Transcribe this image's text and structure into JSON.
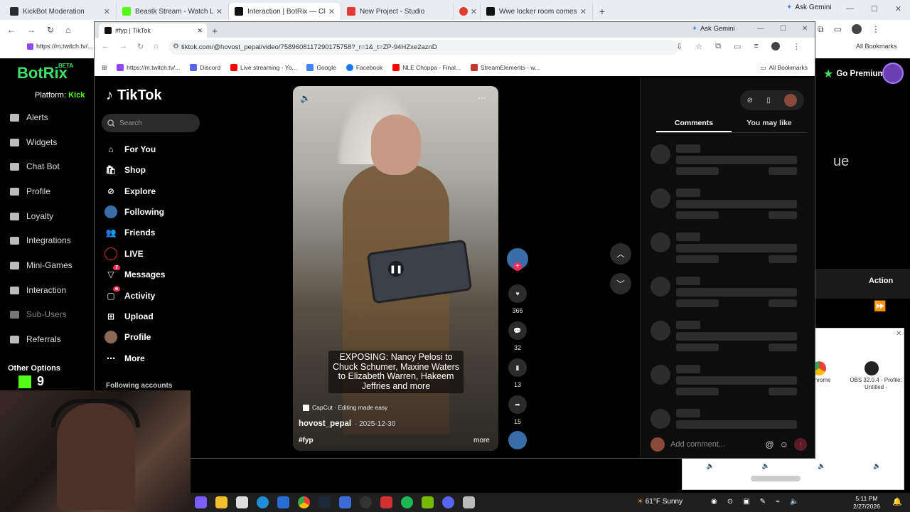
{
  "outer_browser": {
    "tabs": [
      {
        "title": "KickBot Moderation",
        "color": "#2c2c2c"
      },
      {
        "title": "Beastk Stream - Watch Live on",
        "color": "#53fc18"
      },
      {
        "title": "Interaction | BotRix — Cloud Sh",
        "color": "#111111"
      },
      {
        "title": "New Project - Studio",
        "color": "#e53935"
      },
      {
        "title": "",
        "color": "#e53935"
      },
      {
        "title": "Wwe locker room comes out to",
        "color": "#111111"
      }
    ],
    "ask_gemini": "Ask Gemini",
    "bookmark_url": "https://m.twitch.tv/...",
    "all_bookmarks": "All Bookmarks"
  },
  "inner_browser": {
    "tab_title": "#fyp | TikTok",
    "ask_gemini": "Ask Gemini",
    "url": "tiktok.com/@hovost_pepal/video/7589608117290175758?_r=1&_t=ZP-94HZxe2aznD",
    "bookmarks": [
      {
        "label": "https://m.twitch.tv/...",
        "color": "#9146ff"
      },
      {
        "label": "Discord",
        "color": "#5865f2"
      },
      {
        "label": "Live streaming - Yo...",
        "color": "#ff0000"
      },
      {
        "label": "Google",
        "color": "#4285f4"
      },
      {
        "label": "Facebook",
        "color": "#1877f2"
      },
      {
        "label": "NLE Choppa - Final...",
        "color": "#ff0000"
      },
      {
        "label": "StreamElements - w...",
        "color": "#c0392b"
      }
    ],
    "all_bookmarks": "All Bookmarks"
  },
  "tiktok": {
    "logo": "TikTok",
    "search_placeholder": "Search",
    "nav": [
      {
        "label": "For You",
        "icon": "home-icon"
      },
      {
        "label": "Shop",
        "icon": "shop-icon"
      },
      {
        "label": "Explore",
        "icon": "compass-icon"
      },
      {
        "label": "Following",
        "icon": "following-avatar-icon"
      },
      {
        "label": "Friends",
        "icon": "friends-icon"
      },
      {
        "label": "LIVE",
        "icon": "live-icon"
      },
      {
        "label": "Messages",
        "icon": "messages-icon",
        "badge": "7"
      },
      {
        "label": "Activity",
        "icon": "activity-icon",
        "badge": "6"
      },
      {
        "label": "Upload",
        "icon": "upload-icon"
      },
      {
        "label": "Profile",
        "icon": "profile-avatar-icon"
      },
      {
        "label": "More",
        "icon": "more-icon"
      }
    ],
    "following_accounts": "Following accounts",
    "video": {
      "caption": "EXPOSING: Nancy Pelosi to Chuck Schumer, Maxine Waters to Elizabeth Warren, Hakeem Jeffries and more",
      "capcut": "CapCut · Editing made easy",
      "author": "hovost_pepal",
      "date": "· 2025-12-30",
      "hashtag": "#fyp",
      "more": "more"
    },
    "actions": {
      "likes": "366",
      "comments": "32",
      "saves": "13",
      "shares": "15"
    },
    "comments_panel": {
      "tabs": [
        "Comments",
        "You may like"
      ],
      "input_placeholder": "Add comment..."
    }
  },
  "botrix": {
    "logo": "BotRix",
    "beta": "BETA",
    "platform_label": "Platform:",
    "platform_value": "Kick",
    "nav": [
      "Alerts",
      "Widgets",
      "Chat Bot",
      "Profile",
      "Loyalty",
      "Integrations",
      "Mini-Games",
      "Interaction",
      "Sub-Users",
      "Referrals"
    ],
    "other_options": "Other Options",
    "kick_count": "9",
    "go_premium": "Go Premium",
    "action_header": "Action",
    "partial_text": "ue"
  },
  "popup": {
    "chrome_label": "Chrome",
    "obs_label": "OBS 32.0.4 - Profile: Untitled -"
  },
  "taskbar": {
    "weather": "61°F  Sunny",
    "time": "5:11 PM",
    "date": "2/27/2026"
  }
}
